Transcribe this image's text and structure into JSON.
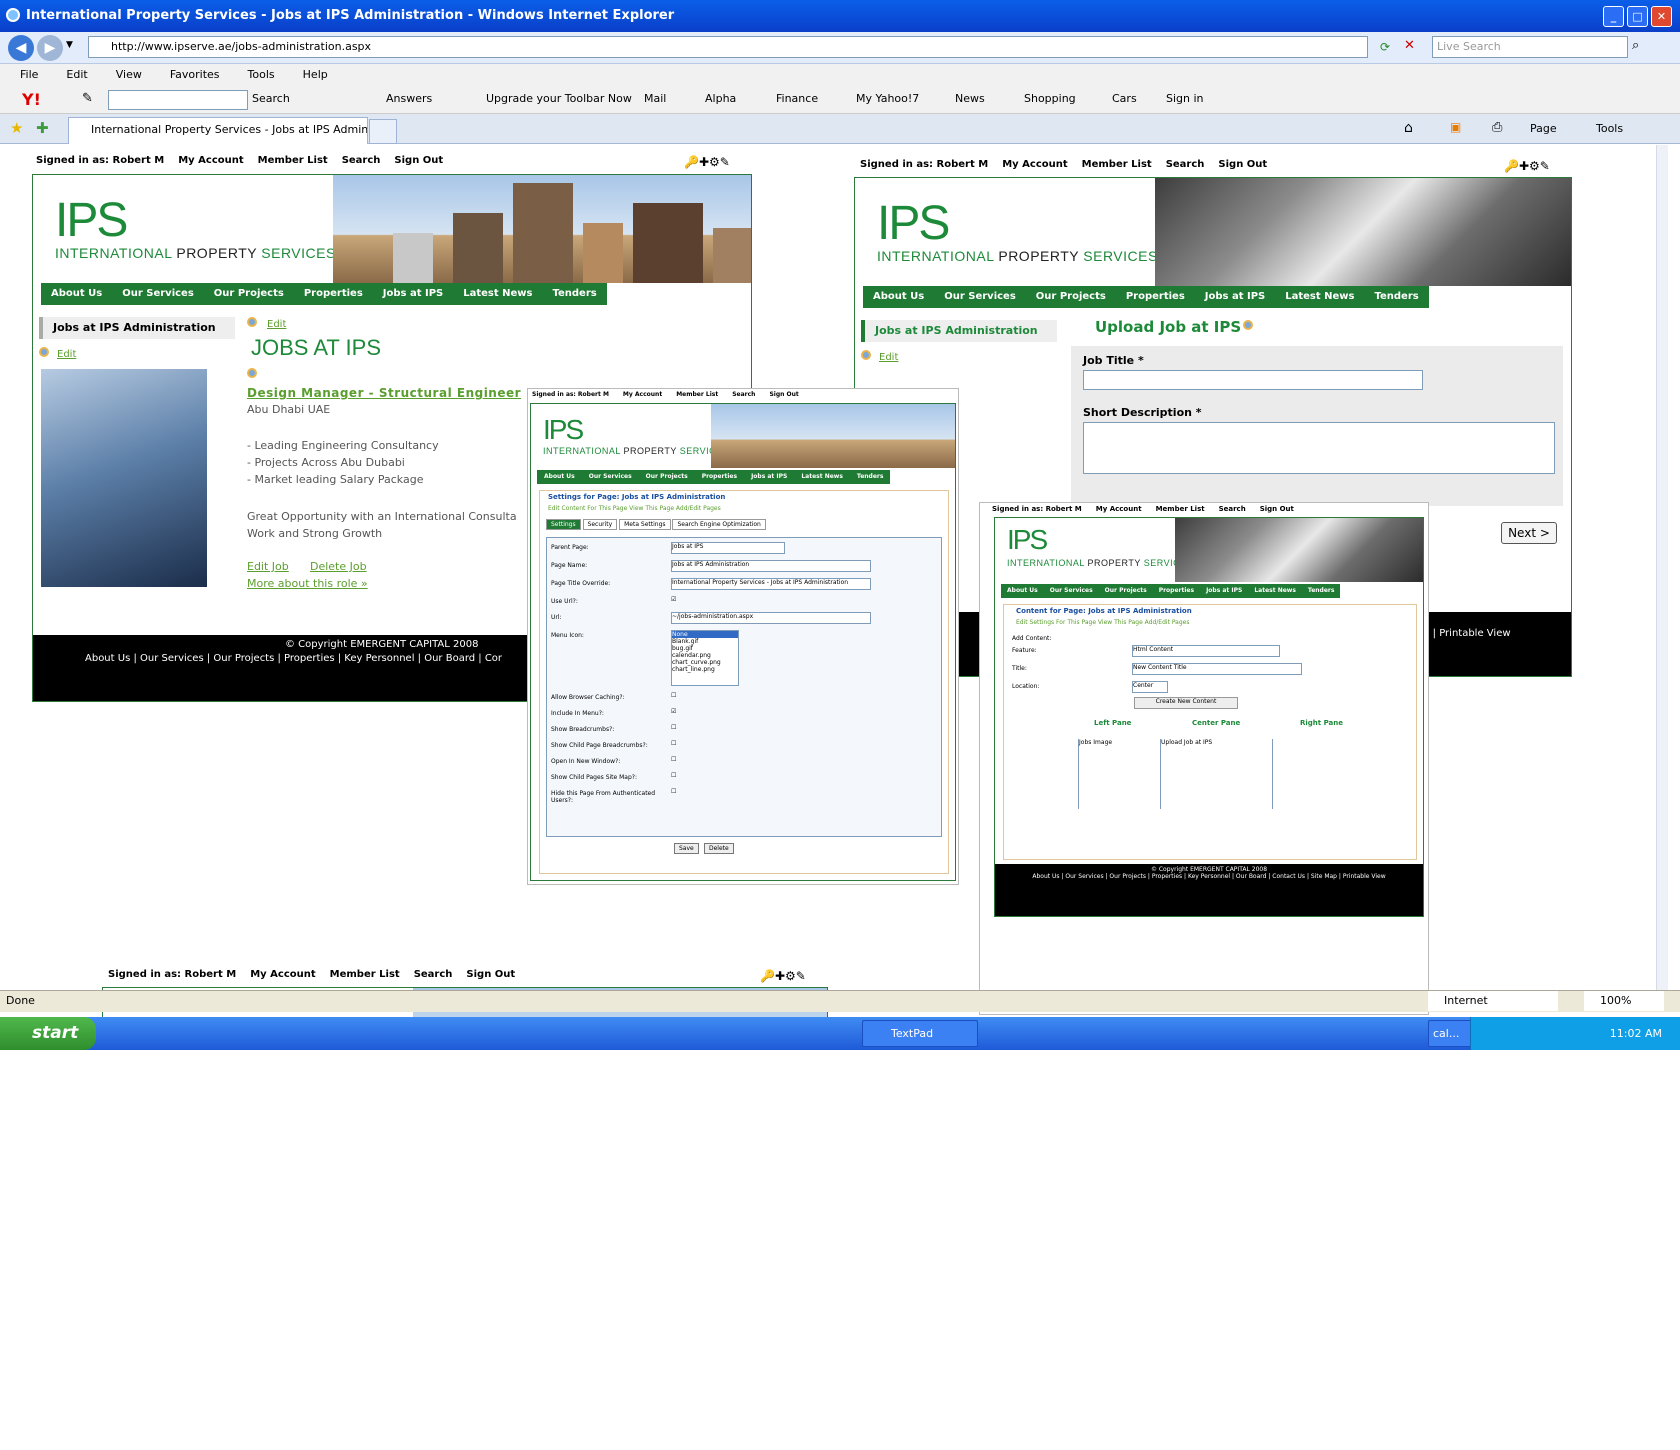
{
  "window": {
    "title": "International Property Services - Jobs at IPS Administration - Windows Internet Explorer"
  },
  "browser": {
    "url": "http://www.ipserve.ae/jobs-administration.aspx",
    "search_placeholder": "Live Search",
    "menu": [
      "File",
      "Edit",
      "View",
      "Favorites",
      "Tools",
      "Help"
    ],
    "toolbar": {
      "search": "Search",
      "answers": "Answers",
      "upgrade": "Upgrade your Toolbar Now",
      "mail": "Mail",
      "alpha": "Alpha",
      "finance": "Finance",
      "myyahoo": "My Yahoo!7",
      "news": "News",
      "shopping": "Shopping",
      "cars": "Cars",
      "signin": "Sign in"
    },
    "tab_title": "International Property Services - Jobs at IPS Administ...",
    "cmd": {
      "page": "Page",
      "tools": "Tools"
    },
    "status": {
      "text": "Done",
      "zone": "Internet",
      "zoom": "100%"
    }
  },
  "taskbar": {
    "start": "start",
    "textpad": "TextPad",
    "cal": "cal...",
    "clock": "11:02 AM"
  },
  "site": {
    "signed_in": "Signed in as: Robert M",
    "links": [
      "My Account",
      "Member List",
      "Search",
      "Sign Out"
    ],
    "logo": "IPS",
    "tagline_a": "INTERNATIONAL",
    "tagline_b": "PROPERTY",
    "tagline_c": "SERVICES",
    "nav": [
      "About Us",
      "Our Services",
      "Our Projects",
      "Properties",
      "Jobs at IPS",
      "Latest News",
      "Tenders"
    ],
    "copyright": "© Copyright EMERGENT CAPITAL 2008",
    "footer_links": "About Us | Our Services | Our Projects | Properties | Key Personnel | Our Board | Cor",
    "printable": "ap | Printable View"
  },
  "win1": {
    "sidebar_title": "Jobs at IPS Administration",
    "edit": "Edit",
    "heading": "JOBS AT IPS",
    "job_title": "Design Manager - Structural Engineer",
    "location": "Abu Dhabi UAE",
    "bullets": [
      "- Leading Engineering Consultancy",
      "- Projects Across Abu Dubabi",
      "- Market leading Salary Package"
    ],
    "desc1": "Great Opportunity with an International Consulta",
    "desc2": "Work and Strong Growth",
    "edit_job": "Edit Job",
    "delete_job": "Delete Job",
    "more": "More about this role »"
  },
  "win2": {
    "sidebar_title": "Jobs at IPS Administration",
    "edit": "Edit",
    "heading": "Upload Job at IPS",
    "job_title_label": "Job Title *",
    "short_desc_label": "Short Description *",
    "next": "Next >"
  },
  "win3": {
    "title": "Settings for Page: Jobs at IPS Administration",
    "sublinks": "Edit Content For This Page  View This Page  Add/Edit Pages",
    "tabs": [
      "Settings",
      "Security",
      "Meta Settings",
      "Search Engine Optimization"
    ],
    "labels": [
      "Parent Page:",
      "Page Name:",
      "Page Title Override:",
      "Use Url?:",
      "Url:",
      "Menu Icon:",
      "Allow Browser Caching?:",
      "Include In Menu?:",
      "Show Breadcrumbs?:",
      "Show Child Page Breadcrumbs?:",
      "Open In New Window?:",
      "Show Child Pages Site Map?:",
      "Hide this Page From Authenticated Users?:"
    ],
    "parent_page": "Jobs at IPS",
    "page_name": "Jobs at IPS Administration",
    "page_title": "International Property Services - Jobs at IPS Administration",
    "url": "~/jobs-administration.aspx",
    "icons": [
      "None",
      "Blank.gif",
      "bug.gif",
      "calendar.png",
      "chart_curve.png",
      "chart_line.png"
    ],
    "save": "Save",
    "delete": "Delete"
  },
  "win4": {
    "title": "Content for Page: Jobs at IPS Administration",
    "sublinks": "Edit Settings For This Page  View This Page  Add/Edit Pages",
    "add_content": "Add Content:",
    "feature_label": "Feature:",
    "feature": "Html Content",
    "title_label": "Title:",
    "title_val": "New Content Title",
    "location_label": "Location:",
    "location": "Center",
    "create": "Create New Content",
    "panes": [
      "Left Pane",
      "Center Pane",
      "Right Pane"
    ],
    "left_item": "Jobs Image",
    "center_item": "Upload Job at IPS",
    "copyright": "© Copyright EMERGENT CAPITAL 2008",
    "footer": "About Us | Our Services | Our Projects | Properties | Key Personnel | Our Board | Contact Us | Site Map | Printable View"
  },
  "colors": {
    "green": "#1f7a33",
    "link_green": "#5a9e2e",
    "xp_blue": "#0a5fe8"
  }
}
